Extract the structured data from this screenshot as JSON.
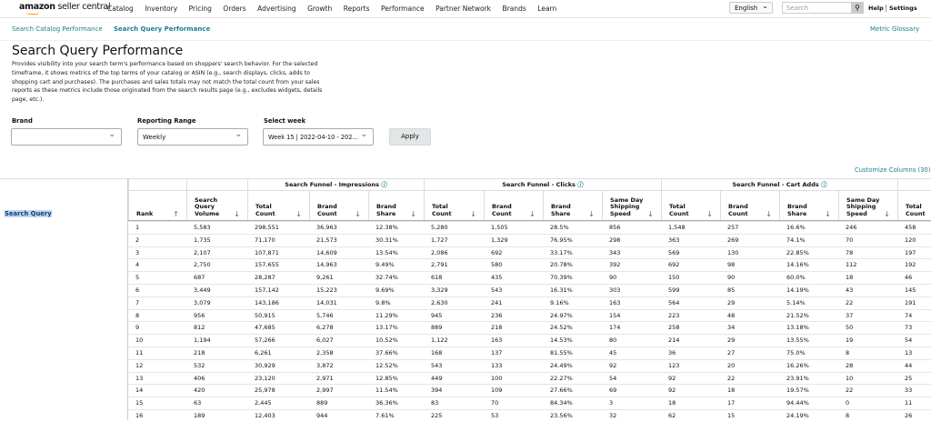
{
  "header": {
    "logo": "amazon seller central",
    "nav": [
      "Catalog",
      "Inventory",
      "Pricing",
      "Orders",
      "Advertising",
      "Growth",
      "Reports",
      "Performance",
      "Partner Network",
      "Brands",
      "Learn"
    ],
    "language": "English",
    "search_placeholder": "Search",
    "help": "Help",
    "settings": "Settings"
  },
  "subnav": {
    "tabs": [
      "Search Catalog Performance",
      "Search Query Performance"
    ],
    "active": 1,
    "glossary": "Metric Glossary"
  },
  "page": {
    "title": "Search Query Performance",
    "description": "Provides visibility into your search term's performance based on shoppers' search behavior. For the selected timeframe, it shows metrics of the top terms of your catalog or ASIN (e.g., search displays, clicks, adds to shopping cart and purchases). The purchases and sales totals may not match the total count from your sales reports as these metrics include those originated from the search results page (e.g., excludes widgets, details page, etc.)."
  },
  "filters": {
    "brand_label": "Brand",
    "brand_value": "",
    "range_label": "Reporting Range",
    "range_value": "Weekly",
    "week_label": "Select week",
    "week_value": "Week 15 | 2022-04-10 - 202...",
    "apply": "Apply"
  },
  "table": {
    "customize": "Customize Columns (30)",
    "search_query_header": "Search Query",
    "groups": [
      "Search Funnel - Impressions",
      "Search Funnel - Clicks",
      "Search Funnel - Cart Adds"
    ],
    "columns": [
      "Rank",
      "Search Query Volume",
      "Total Count",
      "Brand Count",
      "Brand Share",
      "Total Count",
      "Brand Count",
      "Brand Share",
      "Same Day Shipping Speed",
      "Total Count",
      "Brand Count",
      "Brand Share",
      "Same Day Shipping Speed",
      "Total Count"
    ],
    "rows": [
      [
        "1",
        "5,583",
        "298,551",
        "36,963",
        "12.38%",
        "5,280",
        "1,505",
        "28.5%",
        "856",
        "1,548",
        "257",
        "16.6%",
        "246",
        "458"
      ],
      [
        "2",
        "1,735",
        "71,170",
        "21,573",
        "30.31%",
        "1,727",
        "1,329",
        "76.95%",
        "298",
        "363",
        "269",
        "74.1%",
        "70",
        "120"
      ],
      [
        "3",
        "2,107",
        "107,871",
        "14,609",
        "13.54%",
        "2,086",
        "692",
        "33.17%",
        "343",
        "569",
        "130",
        "22.85%",
        "78",
        "197"
      ],
      [
        "4",
        "2,750",
        "157,655",
        "14,963",
        "9.49%",
        "2,791",
        "580",
        "20.78%",
        "392",
        "692",
        "98",
        "14.16%",
        "112",
        "192"
      ],
      [
        "5",
        "687",
        "28,287",
        "9,261",
        "32.74%",
        "618",
        "435",
        "70.39%",
        "90",
        "150",
        "90",
        "60.0%",
        "18",
        "46"
      ],
      [
        "6",
        "3,449",
        "157,142",
        "15,223",
        "9.69%",
        "3,329",
        "543",
        "16.31%",
        "303",
        "599",
        "85",
        "14.19%",
        "43",
        "145"
      ],
      [
        "7",
        "3,079",
        "143,186",
        "14,031",
        "9.8%",
        "2,630",
        "241",
        "9.16%",
        "163",
        "564",
        "29",
        "5.14%",
        "22",
        "191"
      ],
      [
        "8",
        "956",
        "50,915",
        "5,746",
        "11.29%",
        "945",
        "236",
        "24.97%",
        "154",
        "223",
        "48",
        "21.52%",
        "37",
        "74"
      ],
      [
        "9",
        "812",
        "47,685",
        "6,278",
        "13.17%",
        "889",
        "218",
        "24.52%",
        "174",
        "258",
        "34",
        "13.18%",
        "50",
        "73"
      ],
      [
        "10",
        "1,194",
        "57,266",
        "6,027",
        "10.52%",
        "1,122",
        "163",
        "14.53%",
        "80",
        "214",
        "29",
        "13.55%",
        "19",
        "54"
      ],
      [
        "11",
        "218",
        "6,261",
        "2,358",
        "37.66%",
        "168",
        "137",
        "81.55%",
        "45",
        "36",
        "27",
        "75.0%",
        "8",
        "13"
      ],
      [
        "12",
        "532",
        "30,929",
        "3,872",
        "12.52%",
        "543",
        "133",
        "24.49%",
        "92",
        "123",
        "20",
        "16.26%",
        "28",
        "44"
      ],
      [
        "13",
        "406",
        "23,120",
        "2,971",
        "12.85%",
        "449",
        "100",
        "22.27%",
        "54",
        "92",
        "22",
        "23.91%",
        "10",
        "25"
      ],
      [
        "14",
        "420",
        "25,978",
        "2,997",
        "11.54%",
        "394",
        "109",
        "27.66%",
        "69",
        "92",
        "18",
        "19.57%",
        "22",
        "33"
      ],
      [
        "15",
        "63",
        "2,445",
        "889",
        "36.36%",
        "83",
        "70",
        "84.34%",
        "3",
        "18",
        "17",
        "94.44%",
        "0",
        "11"
      ],
      [
        "16",
        "189",
        "12,403",
        "944",
        "7.61%",
        "225",
        "53",
        "23.56%",
        "32",
        "62",
        "15",
        "24.19%",
        "8",
        "26"
      ]
    ]
  },
  "colors": {
    "link": "#1a7f8e",
    "highlight": "#bcd9f3",
    "accent": "#ff9900"
  }
}
